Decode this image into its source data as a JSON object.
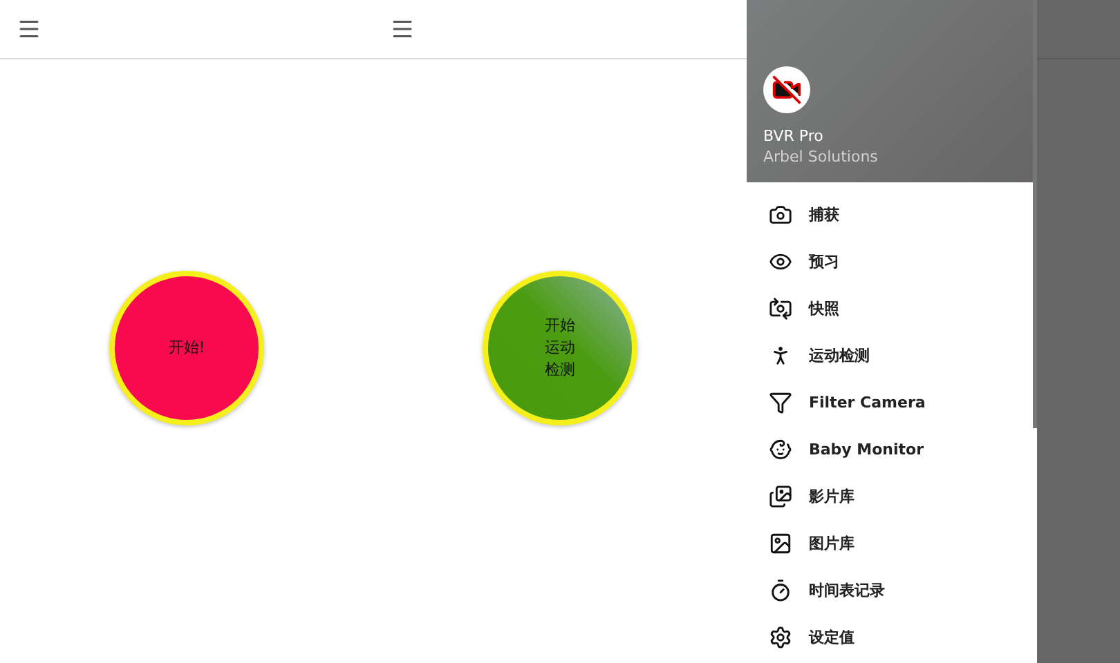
{
  "start_buttons": [
    {
      "label": "开始!",
      "kind": "plain"
    },
    {
      "label": "开始运动检测",
      "kind": "motion"
    }
  ],
  "drawer": {
    "app_name": "BVR Pro",
    "developer": "Arbel Solutions",
    "items": [
      {
        "label": "捕获"
      },
      {
        "label": "预习"
      },
      {
        "label": "快照"
      },
      {
        "label": "运动检测"
      },
      {
        "label": "Filter Camera"
      },
      {
        "label": "Baby Monitor"
      },
      {
        "label": "影片库"
      },
      {
        "label": "图片库"
      },
      {
        "label": "时间表记录"
      },
      {
        "label": "设定值"
      }
    ]
  }
}
